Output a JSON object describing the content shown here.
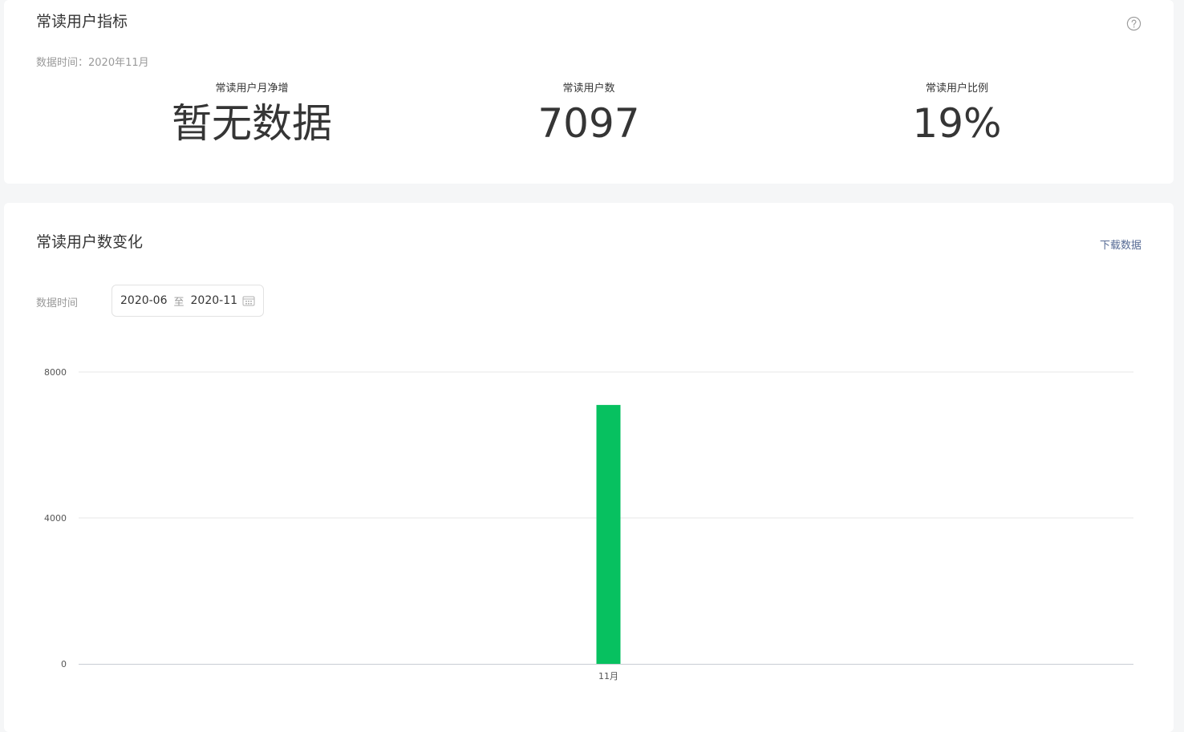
{
  "metrics_card": {
    "title": "常读用户指标",
    "data_time": "数据时间：2020年11月",
    "metrics": [
      {
        "label": "常读用户月净增",
        "value": "暂无数据"
      },
      {
        "label": "常读用户数",
        "value": "7097"
      },
      {
        "label": "常读用户比例",
        "value": "19%"
      }
    ]
  },
  "trend_card": {
    "title": "常读用户数变化",
    "download_label": "下载数据",
    "filter_label": "数据时间",
    "date_start": "2020-06",
    "date_sep": "至",
    "date_end": "2020-11"
  },
  "colors": {
    "bar": "#07c160",
    "link": "#576b95",
    "grid": "#e7e7e7",
    "axis": "#c9cdd4"
  },
  "icons": {
    "help": "help-circle-icon",
    "calendar": "calendar-icon"
  },
  "chart_data": {
    "type": "bar",
    "categories": [
      "11月"
    ],
    "values": [
      7097
    ],
    "ylim": [
      0,
      8000
    ],
    "yticks": [
      0,
      4000,
      8000
    ],
    "grid": true,
    "title": "",
    "xlabel": "",
    "ylabel": ""
  }
}
